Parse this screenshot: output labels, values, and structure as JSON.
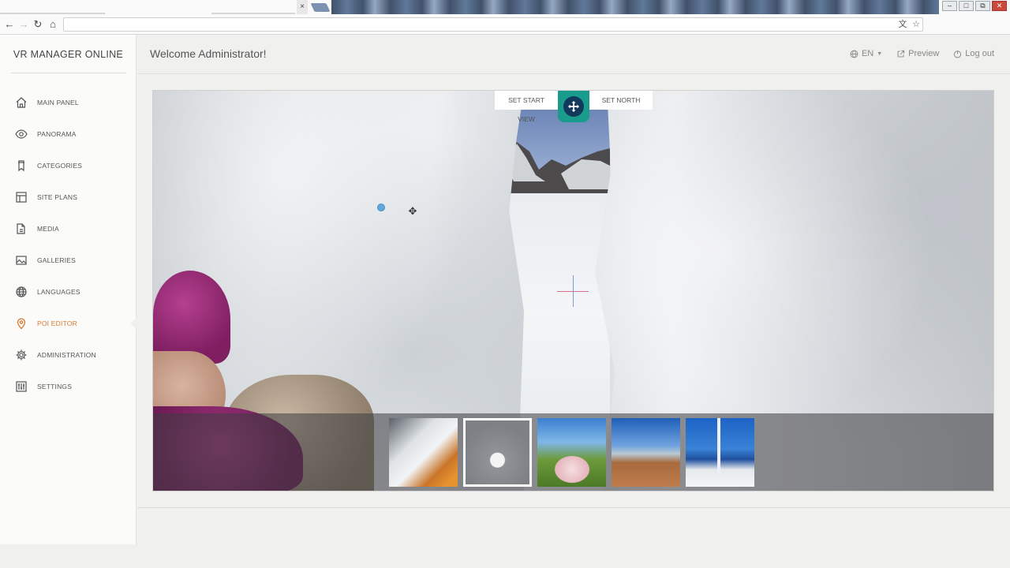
{
  "browser": {
    "close_tab_glyph": "×",
    "window_buttons": [
      "–",
      "□",
      "⧉",
      "✕"
    ],
    "nav": {
      "back": "←",
      "forward": "→",
      "reload": "↻",
      "home": "⌂"
    },
    "address_icons": {
      "translate": "文",
      "bookmark": "☆"
    }
  },
  "sidebar": {
    "brand": "VR MANAGER ONLINE",
    "items": [
      {
        "label": "MAIN PANEL",
        "icon": "home-icon"
      },
      {
        "label": "PANORAMA",
        "icon": "eye-icon"
      },
      {
        "label": "CATEGORIES",
        "icon": "bookmark-icon"
      },
      {
        "label": "SITE PLANS",
        "icon": "layout-icon"
      },
      {
        "label": "MEDIA",
        "icon": "files-icon"
      },
      {
        "label": "GALLERIES",
        "icon": "gallery-icon"
      },
      {
        "label": "LANGUAGES",
        "icon": "globe-icon"
      },
      {
        "label": "POI EDITOR",
        "icon": "map-pin-icon",
        "active": true
      },
      {
        "label": "ADMINISTRATION",
        "icon": "gear-icon"
      },
      {
        "label": "SETTINGS",
        "icon": "sliders-icon"
      }
    ],
    "active_color": "#d9772d"
  },
  "header": {
    "welcome": "Welcome Administrator!",
    "language": "EN",
    "preview": "Preview",
    "logout": "Log out"
  },
  "viewer": {
    "set_start_view": "SET START VIEW",
    "set_north": "SET NORTH",
    "move_button_color": "#1a9c8c",
    "thumbnails": [
      {
        "name": "boat-interior"
      },
      {
        "name": "snow-tunnel",
        "selected": true
      },
      {
        "name": "blossom-garden"
      },
      {
        "name": "rocky-coast"
      },
      {
        "name": "sailboat-deck"
      }
    ]
  }
}
